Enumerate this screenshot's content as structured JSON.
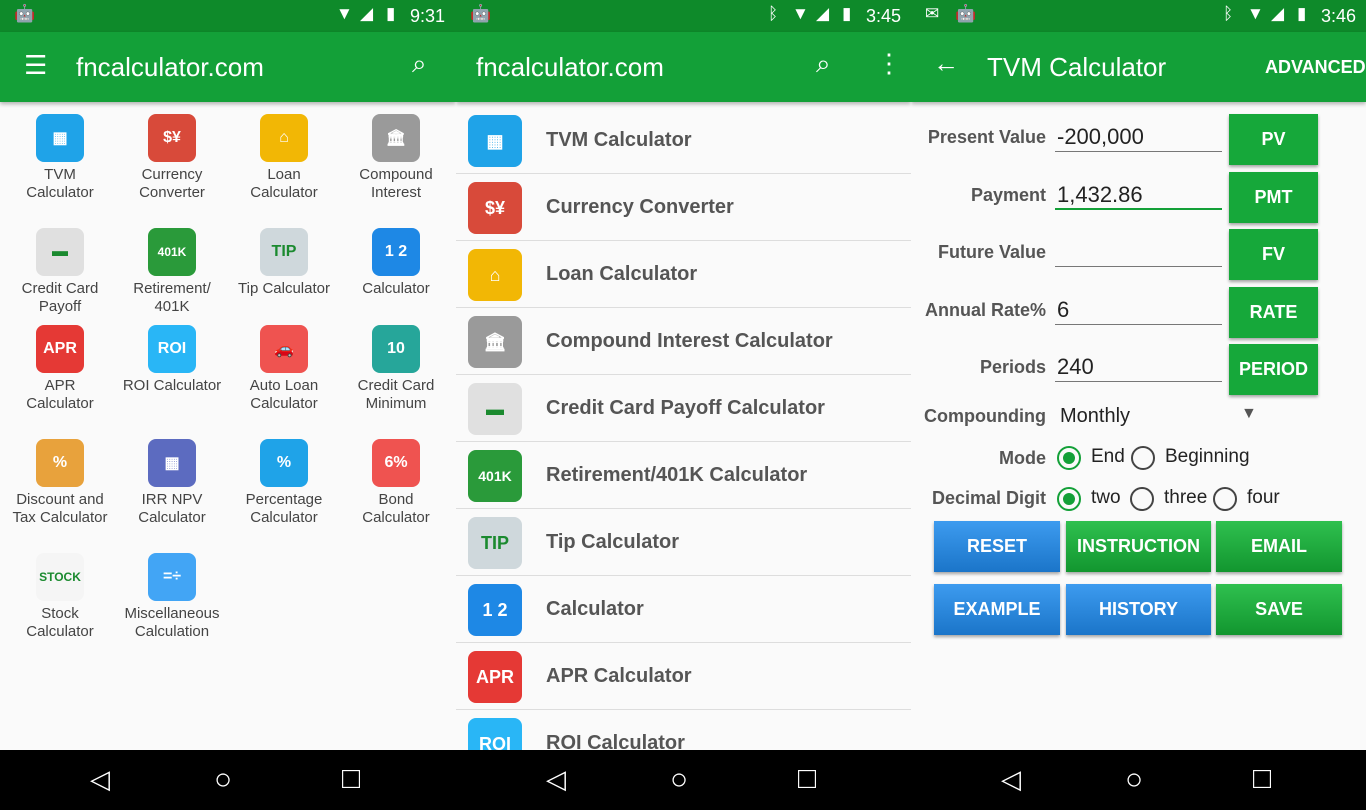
{
  "colors": {
    "accent": "#13a038",
    "status": "#0e8a2a",
    "blue": "#1b75c9"
  },
  "screen1": {
    "time": "9:31",
    "title": "fncalculator.com",
    "menu_icon": "menu-icon",
    "search_icon": "search-icon",
    "grid": [
      {
        "label1": "TVM",
        "label2": "Calculator",
        "icon": "calculator-icon",
        "color": "#1fa3e8",
        "glyph": "▦"
      },
      {
        "label1": "Currency",
        "label2": "Converter",
        "icon": "currency-icon",
        "color": "#d84a3a",
        "glyph": "$¥"
      },
      {
        "label1": "Loan",
        "label2": "Calculator",
        "icon": "house-icon",
        "color": "#f2b705",
        "glyph": "⌂"
      },
      {
        "label1": "Compound",
        "label2": "Interest",
        "icon": "bank-icon",
        "color": "#9a9a9a",
        "glyph": "🏛"
      },
      {
        "label1": "Credit Card",
        "label2": "Payoff",
        "icon": "credit-card-icon",
        "color": "#e0e0e0",
        "glyph": "▬"
      },
      {
        "label1": "Retirement/",
        "label2": "401K",
        "icon": "401k-icon",
        "color": "#2a9a3a",
        "glyph": "401K"
      },
      {
        "label1": "Tip Calculator",
        "label2": "",
        "icon": "tip-icon",
        "color": "#cfd8dc",
        "glyph": "TIP"
      },
      {
        "label1": "Calculator",
        "label2": "",
        "icon": "keypad-icon",
        "color": "#1e88e5",
        "glyph": "1 2"
      },
      {
        "label1": "APR",
        "label2": "Calculator",
        "icon": "apr-icon",
        "color": "#e53935",
        "glyph": "APR"
      },
      {
        "label1": "ROI Calculator",
        "label2": "",
        "icon": "roi-icon",
        "color": "#29b6f6",
        "glyph": "ROI"
      },
      {
        "label1": "Auto Loan",
        "label2": "Calculator",
        "icon": "car-icon",
        "color": "#ef5350",
        "glyph": "🚗"
      },
      {
        "label1": "Credit Card",
        "label2": "Minimum",
        "icon": "card-minimum-icon",
        "color": "#26a69a",
        "glyph": "10"
      },
      {
        "label1": "Discount and",
        "label2": "Tax Calculator",
        "icon": "discount-bag-icon",
        "color": "#e8a23c",
        "glyph": "%"
      },
      {
        "label1": "IRR NPV",
        "label2": "Calculator",
        "icon": "irr-npv-icon",
        "color": "#5c6bc0",
        "glyph": "▦"
      },
      {
        "label1": "Percentage",
        "label2": "Calculator",
        "icon": "percentage-icon",
        "color": "#1fa3e8",
        "glyph": "%"
      },
      {
        "label1": "Bond",
        "label2": "Calculator",
        "icon": "bond-icon",
        "color": "#ef5350",
        "glyph": "6%"
      },
      {
        "label1": "Stock",
        "label2": "Calculator",
        "icon": "stock-icon",
        "color": "#f5f5f5",
        "glyph": "STOCK"
      },
      {
        "label1": "Miscellaneous",
        "label2": "Calculation",
        "icon": "misc-icon",
        "color": "#42a5f5",
        "glyph": "=÷"
      }
    ]
  },
  "screen2": {
    "time": "3:45",
    "title": "fncalculator.com",
    "search_icon": "search-icon",
    "more_icon": "more-vert-icon",
    "list": [
      {
        "label": "TVM Calculator",
        "icon": "calculator-icon",
        "color": "#1fa3e8",
        "glyph": "▦"
      },
      {
        "label": "Currency Converter",
        "icon": "currency-icon",
        "color": "#d84a3a",
        "glyph": "$¥"
      },
      {
        "label": "Loan Calculator",
        "icon": "house-icon",
        "color": "#f2b705",
        "glyph": "⌂"
      },
      {
        "label": "Compound Interest Calculator",
        "icon": "bank-icon",
        "color": "#9a9a9a",
        "glyph": "🏛"
      },
      {
        "label": "Credit Card Payoff Calculator",
        "icon": "credit-card-icon",
        "color": "#e0e0e0",
        "glyph": "▬"
      },
      {
        "label": "Retirement/401K Calculator",
        "icon": "401k-icon",
        "color": "#2a9a3a",
        "glyph": "401K"
      },
      {
        "label": "Tip Calculator",
        "icon": "tip-icon",
        "color": "#cfd8dc",
        "glyph": "TIP"
      },
      {
        "label": "Calculator",
        "icon": "keypad-icon",
        "color": "#1e88e5",
        "glyph": "1 2"
      },
      {
        "label": "APR Calculator",
        "icon": "apr-icon",
        "color": "#e53935",
        "glyph": "APR"
      },
      {
        "label": "ROI Calculator",
        "icon": "roi-icon",
        "color": "#29b6f6",
        "glyph": "ROI"
      }
    ]
  },
  "screen3": {
    "time": "3:46",
    "title": "TVM Calculator",
    "back_icon": "back-arrow-icon",
    "advanced": "ADVANCED",
    "fields": [
      {
        "label": "Present Value",
        "value": "-200,000",
        "button": "PV",
        "active": false
      },
      {
        "label": "Payment",
        "value": "1,432.86",
        "button": "PMT",
        "active": true
      },
      {
        "label": "Future Value",
        "value": "",
        "button": "FV",
        "active": false
      },
      {
        "label": "Annual Rate%",
        "value": "6",
        "button": "RATE",
        "active": false
      },
      {
        "label": "Periods",
        "value": "240",
        "button": "PERIOD",
        "active": false
      }
    ],
    "compounding": {
      "label": "Compounding",
      "value": "Monthly"
    },
    "mode": {
      "label": "Mode",
      "options": [
        "End",
        "Beginning"
      ],
      "selected": "End"
    },
    "decimal": {
      "label": "Decimal Digit",
      "options": [
        "two",
        "three",
        "four"
      ],
      "selected": "two"
    },
    "actions": [
      {
        "label": "RESET",
        "style": "blue"
      },
      {
        "label": "INSTRUCTION",
        "style": "green"
      },
      {
        "label": "EMAIL",
        "style": "green"
      },
      {
        "label": "EXAMPLE",
        "style": "blue"
      },
      {
        "label": "HISTORY",
        "style": "blue"
      },
      {
        "label": "SAVE",
        "style": "green"
      }
    ]
  },
  "navbar": {
    "back": "◁",
    "home": "○",
    "recents": "□"
  }
}
